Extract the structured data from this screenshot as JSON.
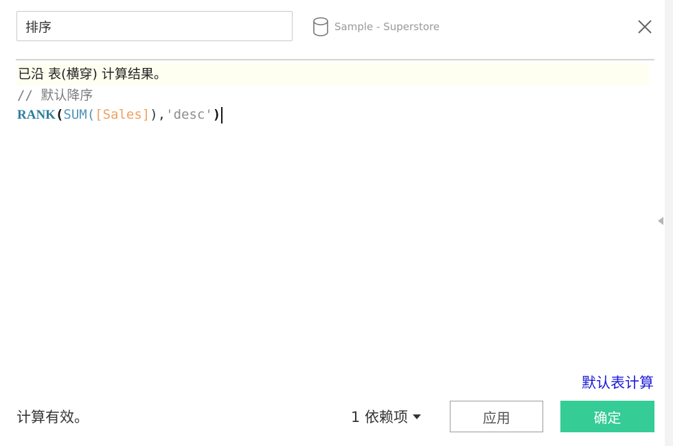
{
  "dialog": {
    "name_field": {
      "value": "排序",
      "placeholder": ""
    },
    "datasource": {
      "icon": "database-icon",
      "label": "Sample - Superstore"
    },
    "close": {
      "icon": "close-icon"
    }
  },
  "info_banner": {
    "text": "已沿 表(横穿) 计算结果。"
  },
  "editor": {
    "comment": {
      "slashes": "// ",
      "text": "默认降序"
    },
    "formula": {
      "keyword": "RANK",
      "open_paren": "(",
      "function": "SUM(",
      "field": "[Sales]",
      "close_fn": ")",
      "comma": ",",
      "string": "'desc'",
      "close_paren": ")"
    }
  },
  "footer": {
    "default_table_calc_link": "默认表计算",
    "status": "计算有效。",
    "dependencies": "1 依赖项",
    "apply_label": "应用",
    "ok_label": "确定"
  },
  "colors": {
    "ok_button": "#35cc96",
    "link": "#1a1adb",
    "banner": "#fefff0",
    "keyword": "#2e7d9c",
    "field": "#f0a05c"
  }
}
